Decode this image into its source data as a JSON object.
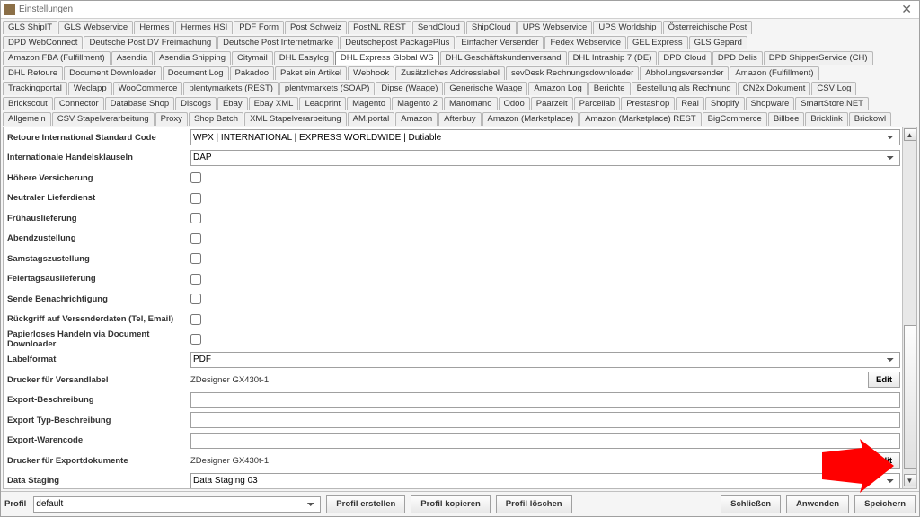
{
  "window": {
    "title": "Einstellungen",
    "close": "✕"
  },
  "tabs": {
    "rows": [
      [
        "GLS ShipIT",
        "GLS Webservice",
        "Hermes",
        "Hermes HSI",
        "PDF Form",
        "Post Schweiz",
        "PostNL REST",
        "SendCloud",
        "ShipCloud",
        "UPS Webservice",
        "UPS Worldship",
        "Österreichische Post"
      ],
      [
        "DPD WebConnect",
        "Deutsche Post DV Freimachung",
        "Deutsche Post Internetmarke",
        "Deutschepost PackagePlus",
        "Einfacher Versender",
        "Fedex Webservice",
        "GEL Express",
        "GLS Gepard"
      ],
      [
        "Amazon FBA (Fulfillment)",
        "Asendia",
        "Asendia Shipping",
        "Citymail",
        "DHL Easylog",
        "DHL Express Global WS",
        "DHL Geschäftskundenversand",
        "DHL Intraship 7 (DE)",
        "DPD Cloud",
        "DPD Delis",
        "DPD ShipperService (CH)"
      ],
      [
        "DHL Retoure",
        "Document Downloader",
        "Document Log",
        "Pakadoo",
        "Paket ein Artikel",
        "Webhook",
        "Zusätzliches Addresslabel",
        "sevDesk Rechnungsdownloader",
        "Abholungsversender",
        "Amazon (Fulfillment)"
      ],
      [
        "Trackingportal",
        "Weclapp",
        "WooCommerce",
        "plentymarkets (REST)",
        "plentymarkets (SOAP)",
        "Dipse (Waage)",
        "Generische Waage",
        "Amazon Log",
        "Berichte",
        "Bestellung als Rechnung",
        "CN2x Dokument",
        "CSV Log"
      ],
      [
        "Brickscout",
        "Connector",
        "Database Shop",
        "Discogs",
        "Ebay",
        "Ebay XML",
        "Leadprint",
        "Magento",
        "Magento 2",
        "Manomano",
        "Odoo",
        "Paarzeit",
        "Parcellab",
        "Prestashop",
        "Real",
        "Shopify",
        "Shopware",
        "SmartStore.NET"
      ],
      [
        "Allgemein",
        "CSV Stapelverarbeitung",
        "Proxy",
        "Shop Batch",
        "XML Stapelverarbeitung",
        "AM.portal",
        "Amazon",
        "Afterbuy",
        "Amazon (Marketplace)",
        "Amazon (Marketplace) REST",
        "BigCommerce",
        "Billbee",
        "Bricklink",
        "Brickowl"
      ]
    ],
    "active": "DHL Express Global WS"
  },
  "form": {
    "retoure_code": {
      "label": "Retoure International Standard Code",
      "value": "WPX | INTERNATIONAL | EXPRESS WORLDWIDE | Dutiable"
    },
    "handelsklauseln": {
      "label": "Internationale Handelsklauseln",
      "value": "DAP"
    },
    "hoehere_versicherung": {
      "label": "Höhere Versicherung"
    },
    "neutraler_lieferdienst": {
      "label": "Neutraler Lieferdienst"
    },
    "fruehauslieferung": {
      "label": "Frühauslieferung"
    },
    "abendzustellung": {
      "label": "Abendzustellung"
    },
    "samstagszustellung": {
      "label": "Samstagszustellung"
    },
    "feiertagsauslieferung": {
      "label": "Feiertagsauslieferung"
    },
    "sende_benachrichtigung": {
      "label": "Sende Benachrichtigung"
    },
    "rueckgriff": {
      "label": "Rückgriff auf Versenderdaten (Tel, Email)"
    },
    "papierlos": {
      "label": "Papierloses Handeln via Document Downloader"
    },
    "labelformat": {
      "label": "Labelformat",
      "value": "PDF"
    },
    "drucker_versandlabel": {
      "label": "Drucker für Versandlabel",
      "value": "ZDesigner GX430t-1",
      "edit": "Edit"
    },
    "export_beschreibung": {
      "label": "Export-Beschreibung",
      "value": ""
    },
    "export_typ": {
      "label": "Export Typ-Beschreibung",
      "value": ""
    },
    "export_warencode": {
      "label": "Export-Warencode",
      "value": ""
    },
    "drucker_export": {
      "label": "Drucker für Exportdokumente",
      "value": "ZDesigner GX430t-1",
      "edit": "Edit"
    },
    "data_staging": {
      "label": "Data Staging",
      "value": "Data Staging 03"
    }
  },
  "bottom": {
    "profil_label": "Profil",
    "profil_value": "default",
    "profil_erstellen": "Profil erstellen",
    "profil_kopieren": "Profil kopieren",
    "profil_loeschen": "Profil löschen",
    "schliessen": "Schließen",
    "anwenden": "Anwenden",
    "speichern": "Speichern"
  }
}
